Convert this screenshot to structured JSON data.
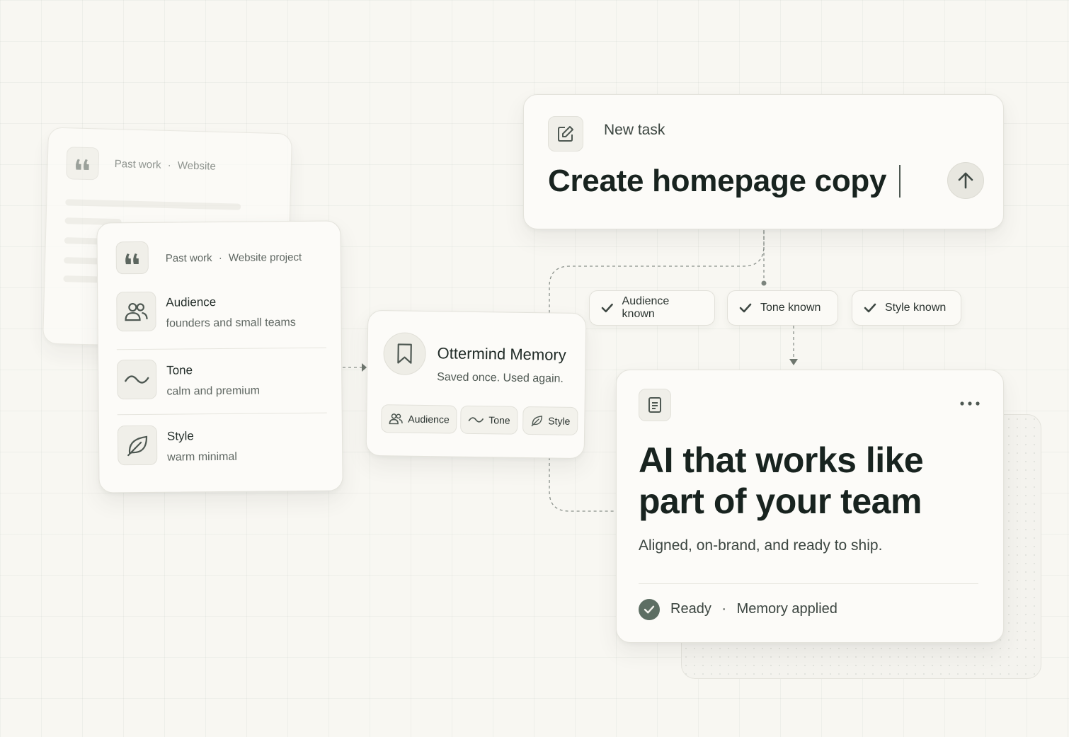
{
  "back_card": {
    "label": "Past work",
    "sep": "·",
    "project": "Website",
    "icon": "quote-icon"
  },
  "source_card": {
    "label": "Past work",
    "sep": "·",
    "project": "Website project",
    "rows": [
      {
        "title": "Audience",
        "value": "founders and small teams",
        "icon": "users-icon"
      },
      {
        "title": "Tone",
        "value": "calm and premium",
        "icon": "wave-icon"
      },
      {
        "title": "Style",
        "value": "warm minimal",
        "icon": "leaf-icon"
      }
    ]
  },
  "memory": {
    "title": "Ottermind Memory",
    "subtitle": "Saved once. Used again.",
    "icon": "bookmark-icon",
    "chips": [
      "Audience",
      "Tone",
      "Style"
    ]
  },
  "task": {
    "label": "New task",
    "input_value": "Create homepage copy",
    "icon": "edit-icon",
    "send_icon": "arrow-up-icon"
  },
  "badges": [
    "Audience known",
    "Tone known",
    "Style known"
  ],
  "result": {
    "headline_line1": "AI that works like",
    "headline_line2": "part of your team",
    "subtext": "Aligned, on-brand, and ready to ship.",
    "status": "Ready",
    "sep": "·",
    "status_detail": "Memory applied",
    "icon": "document-icon",
    "menu_icon": "more-icon"
  },
  "colors": {
    "background": "#f8f7f2",
    "card": "#fcfbf8",
    "accent_green": "#5d6e63",
    "text_dark": "#18231f"
  }
}
